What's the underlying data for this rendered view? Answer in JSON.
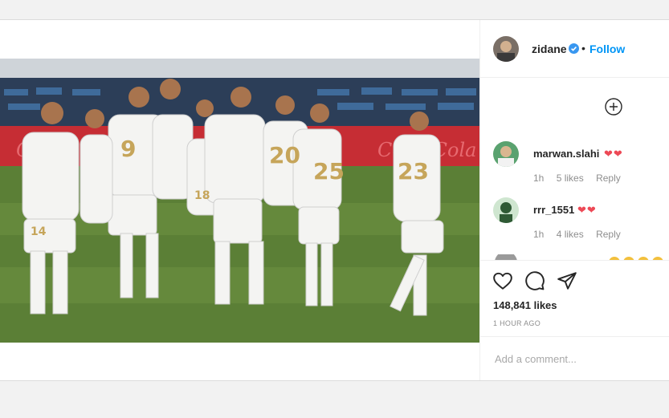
{
  "post": {
    "author": {
      "username": "zidane",
      "verified": true,
      "follow_label": "Follow",
      "separator": "•"
    },
    "image": {
      "description_icon": "photo"
    },
    "comments": [
      {
        "username": "marwan.slahi",
        "emoji": "❤❤",
        "time": "1h",
        "likes": "5 likes",
        "reply_label": "Reply"
      },
      {
        "username": "rrr_1551",
        "emoji": "❤❤",
        "time": "1h",
        "likes": "4 likes",
        "reply_label": "Reply"
      }
    ],
    "like_count": "148,841 likes",
    "timestamp": "1 HOUR AGO",
    "add_comment_placeholder": "Add a comment..."
  },
  "colors": {
    "accent": "#0095f6",
    "heart": "#ed4956",
    "muted": "#8e8e8e",
    "border": "#dbdbdb"
  },
  "icons": {
    "like": "heart-icon",
    "comment": "comment-icon",
    "share": "share-icon",
    "more_comments": "plus-circle-icon",
    "verified": "verified-badge-icon"
  }
}
